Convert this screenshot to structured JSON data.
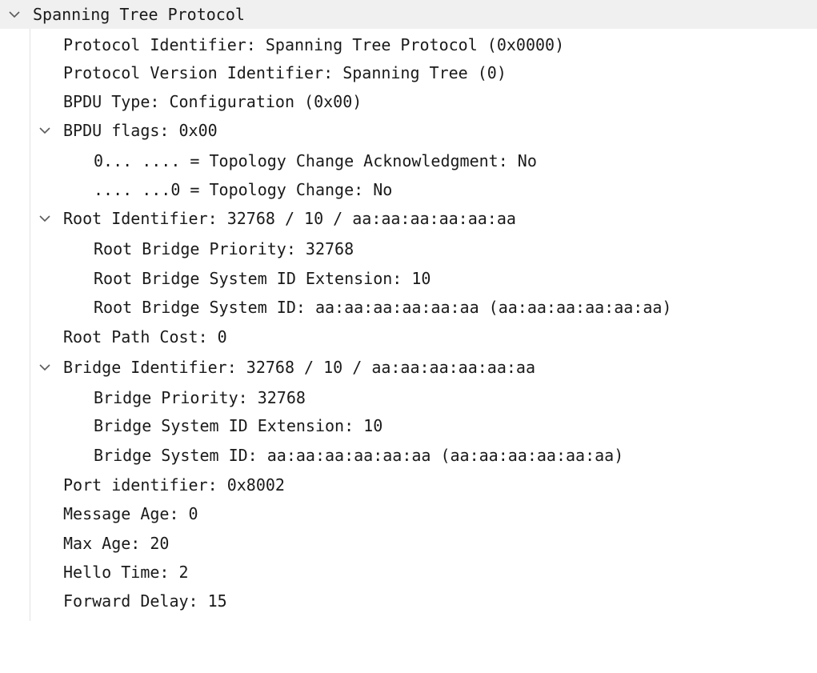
{
  "tree": {
    "root": {
      "label": "Spanning Tree Protocol",
      "expanded": true
    },
    "protocol_identifier": "Protocol Identifier: Spanning Tree Protocol (0x0000)",
    "protocol_version": "Protocol Version Identifier: Spanning Tree (0)",
    "bpdu_type": "BPDU Type: Configuration (0x00)",
    "bpdu_flags": {
      "label": "BPDU flags: 0x00",
      "expanded": true,
      "topology_change_ack": "0... .... = Topology Change Acknowledgment: No",
      "topology_change": ".... ...0 = Topology Change: No"
    },
    "root_identifier": {
      "label": "Root Identifier: 32768 / 10 / aa:aa:aa:aa:aa:aa",
      "expanded": true,
      "priority": "Root Bridge Priority: 32768",
      "system_id_extension": "Root Bridge System ID Extension: 10",
      "system_id": "Root Bridge System ID: aa:aa:aa:aa:aa:aa (aa:aa:aa:aa:aa:aa)"
    },
    "root_path_cost": "Root Path Cost: 0",
    "bridge_identifier": {
      "label": "Bridge Identifier: 32768 / 10 / aa:aa:aa:aa:aa:aa",
      "expanded": true,
      "priority": "Bridge Priority: 32768",
      "system_id_extension": "Bridge System ID Extension: 10",
      "system_id": "Bridge System ID: aa:aa:aa:aa:aa:aa (aa:aa:aa:aa:aa:aa)"
    },
    "port_identifier": "Port identifier: 0x8002",
    "message_age": "Message Age: 0",
    "max_age": "Max Age: 20",
    "hello_time": "Hello Time: 2",
    "forward_delay": "Forward Delay: 15"
  },
  "icons": {
    "expand": "chevron-down-icon"
  },
  "colors": {
    "text": "#1a1a1a",
    "selected_row": "#f0f0f0",
    "chevron": "#5a5a5a"
  }
}
